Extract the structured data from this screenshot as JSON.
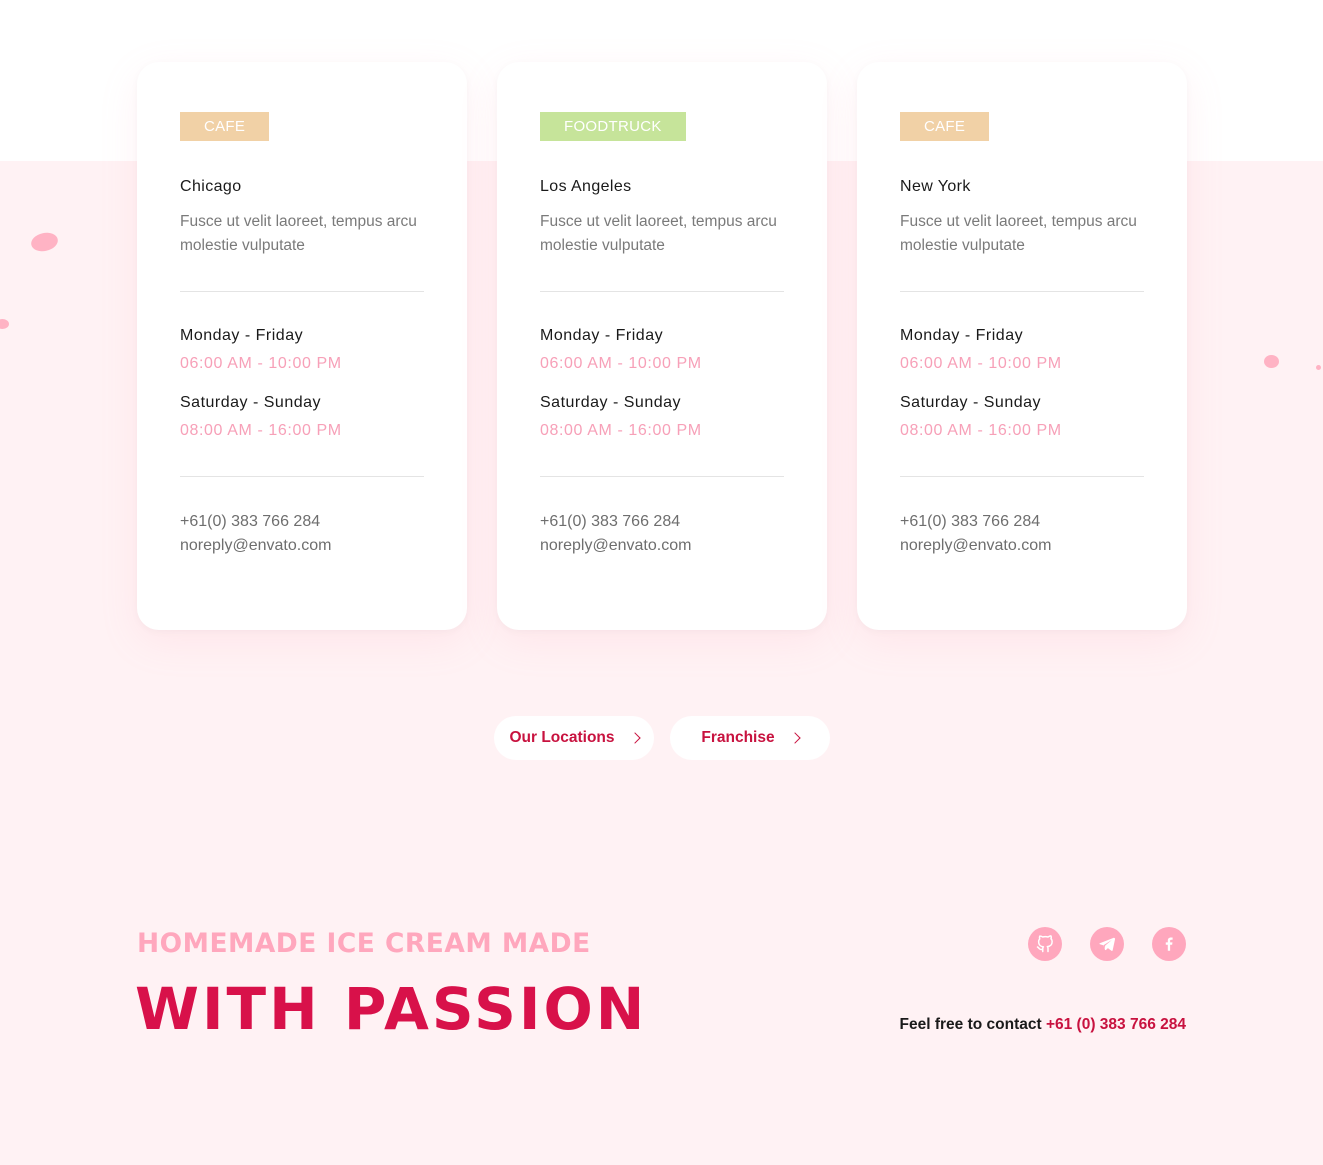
{
  "locations": [
    {
      "badge": "CAFE",
      "badge_color": "#f1d1a6",
      "city": "Chicago",
      "description": "Fusce ut velit laoreet, tempus arcu molestie vulputate",
      "weekday_label": "Monday - Friday",
      "weekday_hours": "06:00 AM - 10:00 PM",
      "weekend_label": "Saturday - Sunday",
      "weekend_hours": "08:00 AM - 16:00 PM",
      "phone": "+61(0) 383 766 284",
      "email": "noreply@envato.com"
    },
    {
      "badge": "FOODTRUCK",
      "badge_color": "#c6e49a",
      "city": "Los Angeles",
      "description": "Fusce ut velit laoreet, tempus arcu molestie vulputate",
      "weekday_label": "Monday - Friday",
      "weekday_hours": "06:00 AM - 10:00 PM",
      "weekend_label": "Saturday - Sunday",
      "weekend_hours": "08:00 AM - 16:00 PM",
      "phone": "+61(0) 383 766 284",
      "email": "noreply@envato.com"
    },
    {
      "badge": "CAFE",
      "badge_color": "#f1d1a6",
      "city": "New York",
      "description": "Fusce ut velit laoreet, tempus arcu molestie vulputate",
      "weekday_label": "Monday - Friday",
      "weekday_hours": "06:00 AM - 10:00 PM",
      "weekend_label": "Saturday - Sunday",
      "weekend_hours": "08:00 AM - 16:00 PM",
      "phone": "+61(0) 383 766 284",
      "email": "noreply@envato.com"
    }
  ],
  "buttons": {
    "locations_label": "Our Locations",
    "franchise_label": "Franchise"
  },
  "hero": {
    "line1": "HOMEMADE ICE CREAM MADE",
    "line2": "WITH PASSION"
  },
  "social": [
    "github-icon",
    "telegram-icon",
    "facebook-icon"
  ],
  "contact": {
    "prefix": "Feel free to contact",
    "phone": "+61 (0) 383 766 284"
  },
  "colors": {
    "accent": "#d8114a",
    "pink": "#ffa7bd",
    "hours": "#f7a0b8",
    "background": "#fff2f4"
  }
}
